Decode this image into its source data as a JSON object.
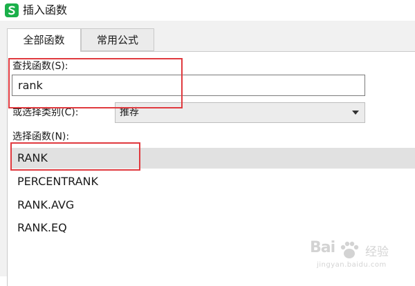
{
  "window": {
    "title": "插入函数",
    "app_icon": "wps-spreadsheet-icon",
    "app_icon_color": "#1bb04a",
    "app_icon_letter": "S"
  },
  "tabs": [
    {
      "label": "全部函数",
      "active": true
    },
    {
      "label": "常用公式",
      "active": false
    }
  ],
  "search": {
    "label": "查找函数(S):",
    "value": "rank"
  },
  "category": {
    "label": "或选择类别(C):",
    "selected": "推荐"
  },
  "function_list": {
    "label": "选择函数(N):",
    "items": [
      "RANK",
      "PERCENTRANK",
      "RANK.AVG",
      "RANK.EQ"
    ],
    "selected_index": 0
  },
  "annotation_color": "#e0393e",
  "watermark": {
    "logo": "Bai",
    "word": "经验",
    "url": "jingyan.baidu.com"
  }
}
